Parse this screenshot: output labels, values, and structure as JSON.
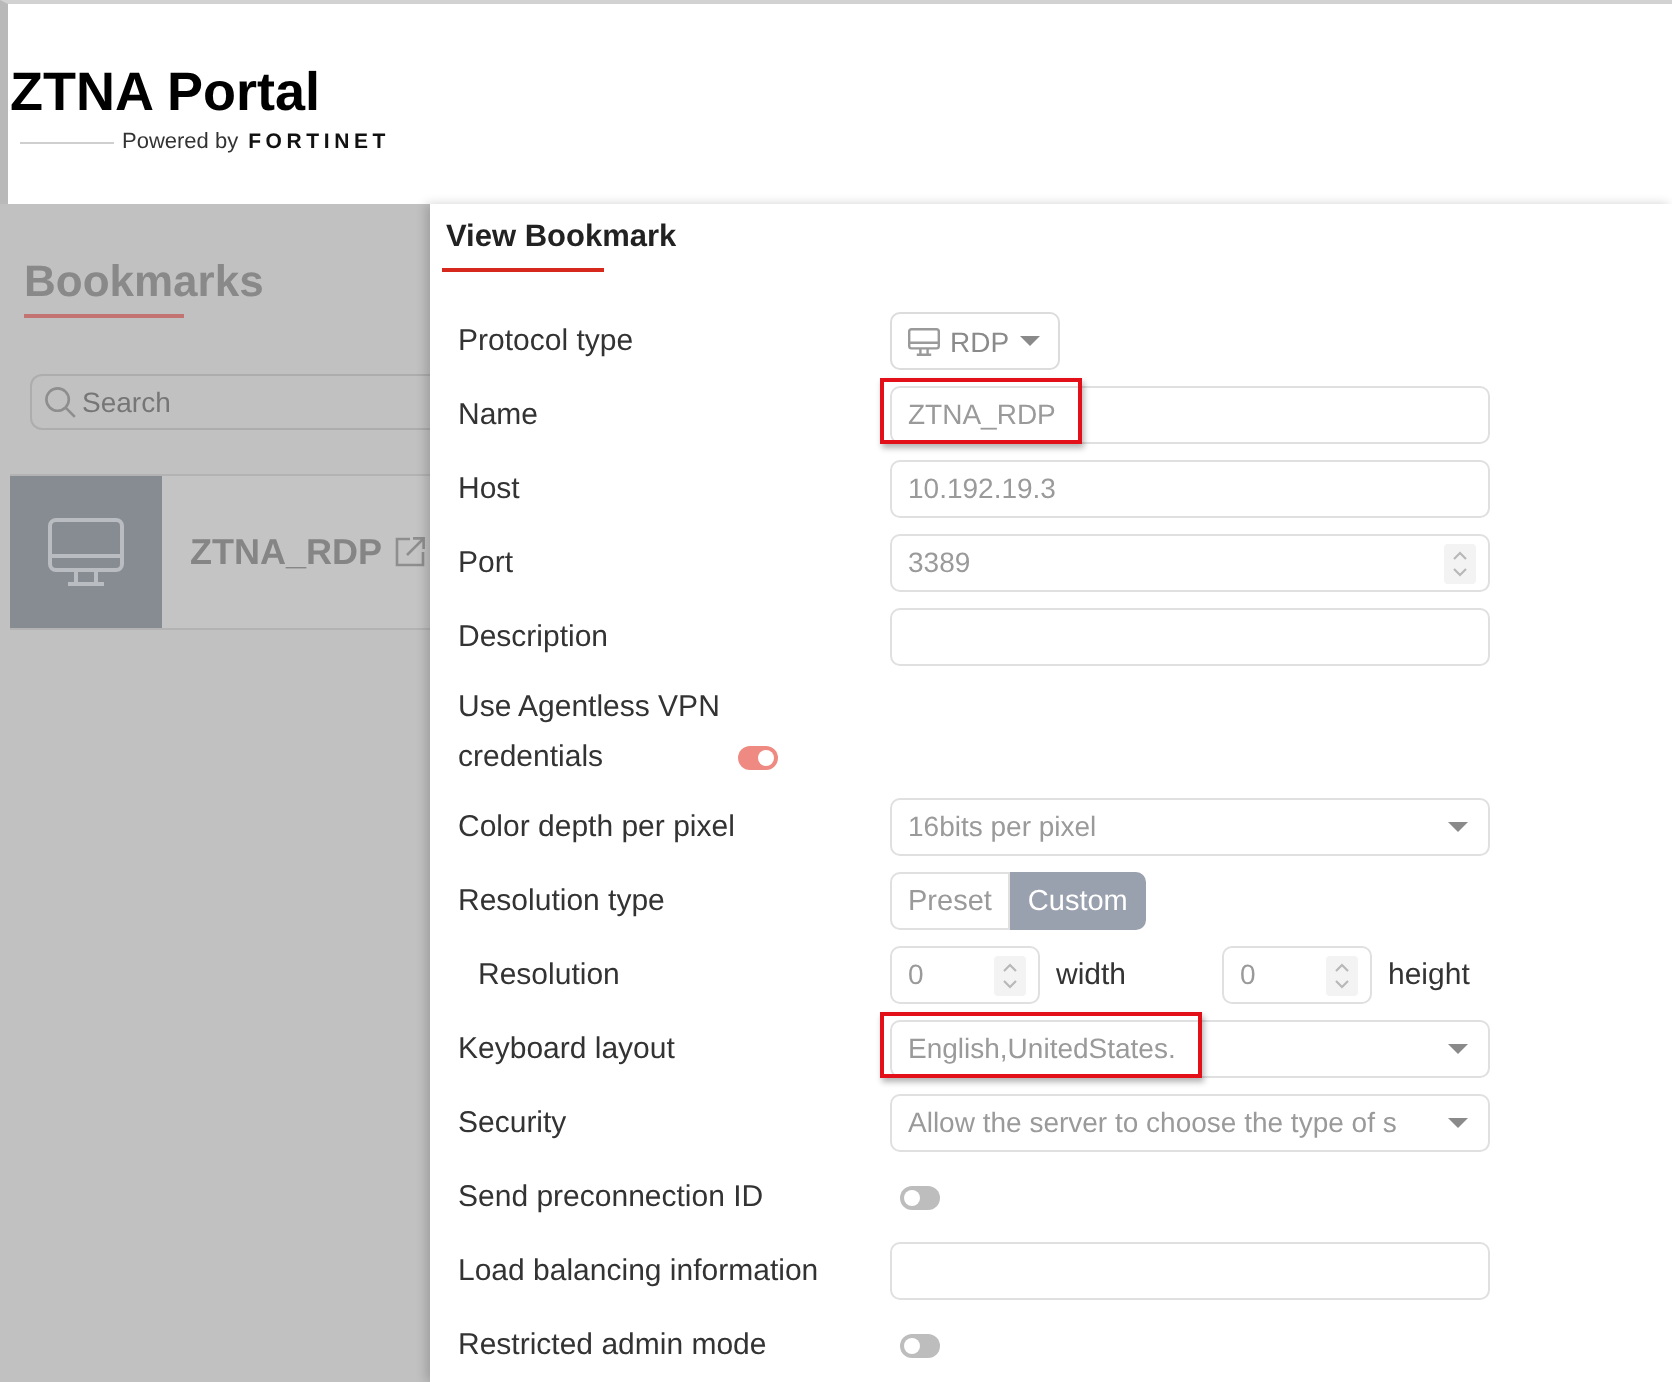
{
  "header": {
    "title": "ZTNA Portal",
    "powered_by": "Powered by",
    "brand": "FORTINET"
  },
  "sidebar": {
    "heading": "Bookmarks",
    "search": {
      "placeholder": "Search"
    },
    "bookmarks": [
      {
        "name": "ZTNA_RDP"
      }
    ]
  },
  "drawer": {
    "title": "View Bookmark",
    "fields": [
      {
        "kind": "select-button",
        "label": "Protocol type",
        "value": "RDP"
      },
      {
        "kind": "text",
        "label": "Name",
        "value": "ZTNA_RDP",
        "highlighted": true
      },
      {
        "kind": "text",
        "label": "Host",
        "value": "10.192.19.3",
        "highlighted": false
      },
      {
        "kind": "number",
        "label": "Port",
        "value": "3389",
        "highlighted": false
      },
      {
        "kind": "text",
        "label": "Description",
        "highlighted": false
      },
      {
        "kind": "inline-toggle",
        "label": "Use Agentless VPN credentials",
        "on": true
      },
      {
        "kind": "select",
        "label": "Color depth per pixel",
        "value": "16bits per pixel",
        "highlighted": false
      },
      {
        "kind": "segmented",
        "label": "Resolution type",
        "options": [
          {
            "label": "Preset",
            "selected": false
          },
          {
            "label": "Custom",
            "selected": true
          }
        ]
      },
      {
        "kind": "resolution",
        "label": "Resolution",
        "inputs": [
          {
            "value": "0",
            "unit": "width"
          },
          {
            "value": "0",
            "unit": "height"
          }
        ]
      },
      {
        "kind": "select",
        "label": "Keyboard layout",
        "value": "English,UnitedStates.",
        "highlighted": true
      },
      {
        "kind": "select",
        "label": "Security",
        "value": "Allow the server to choose the type of s",
        "highlighted": false
      },
      {
        "kind": "toggle",
        "label": "Send preconnection ID",
        "on": false
      },
      {
        "kind": "text",
        "label": "Load balancing information",
        "highlighted": false
      },
      {
        "kind": "toggle",
        "label": "Restricted admin mode",
        "on": false
      }
    ]
  }
}
